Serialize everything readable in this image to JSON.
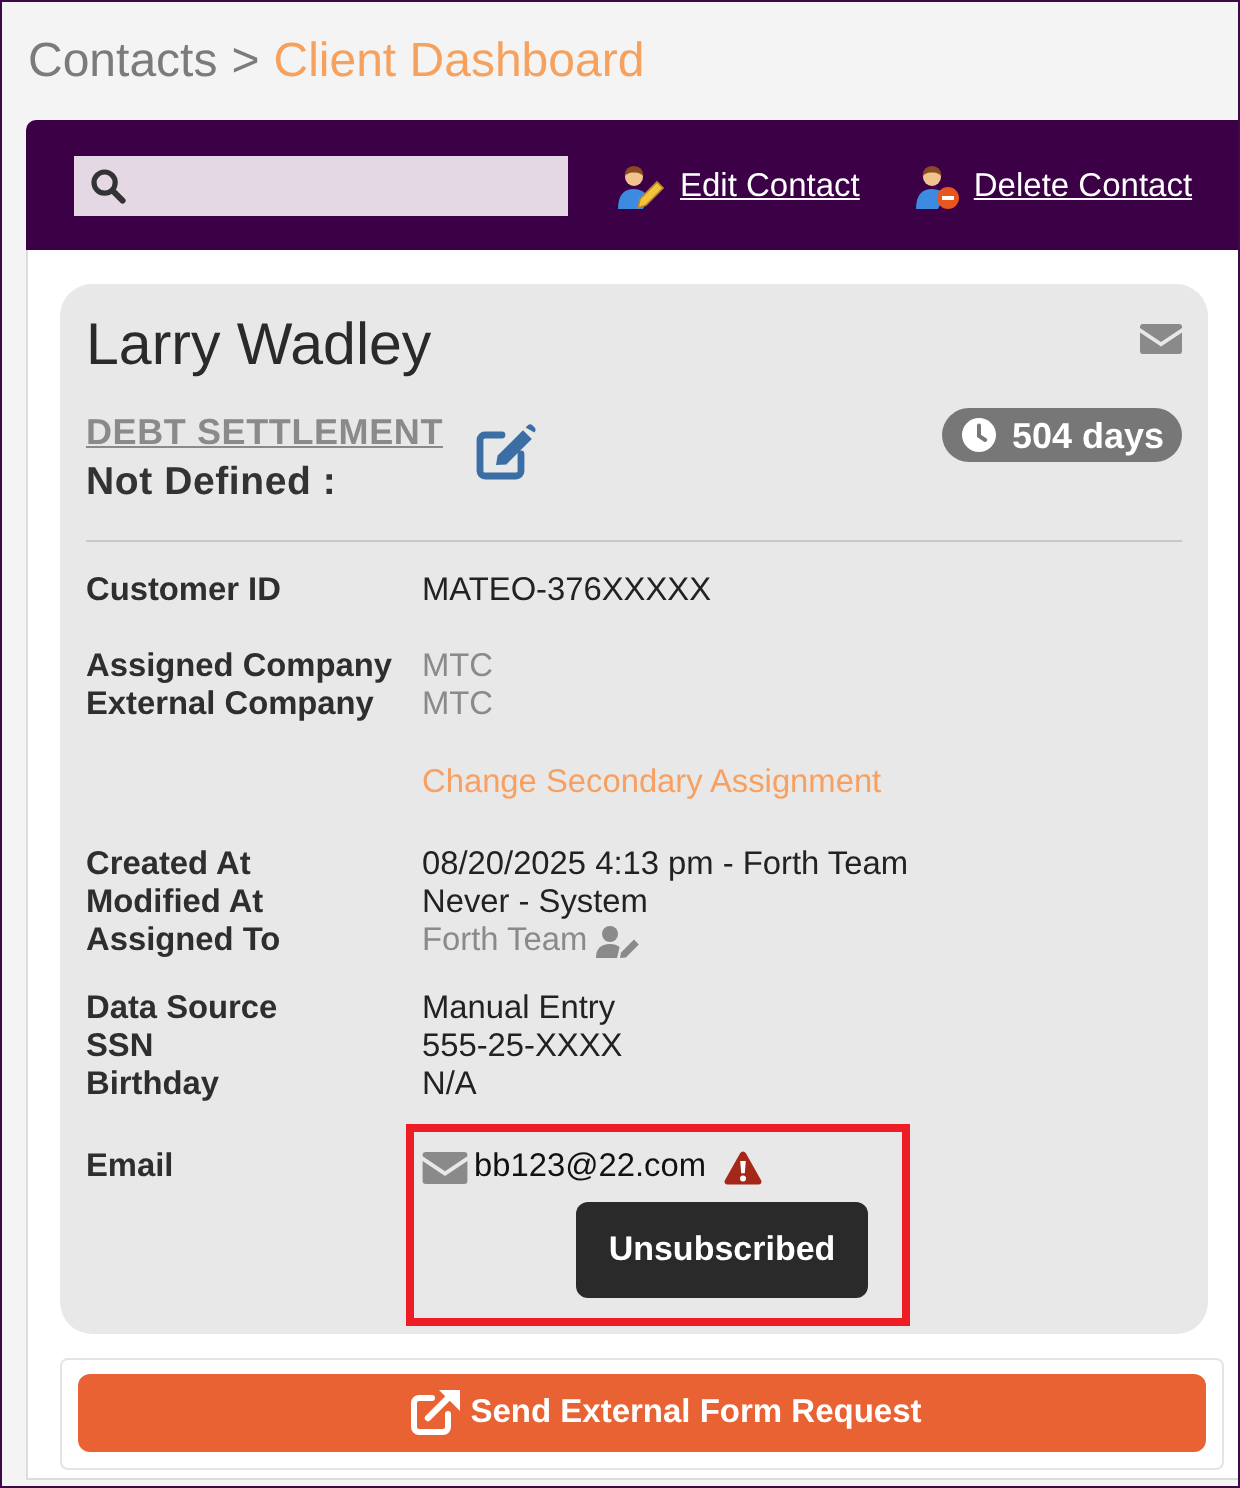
{
  "breadcrumb": {
    "parent": "Contacts",
    "separator": ">",
    "current": "Client Dashboard"
  },
  "toolbar": {
    "actions": [
      {
        "kind": "edit",
        "label": "Edit Contact"
      },
      {
        "kind": "delete",
        "label": "Delete Contact"
      }
    ]
  },
  "contact": {
    "name": "Larry Wadley",
    "category": "DEBT SETTLEMENT",
    "status": "Not Defined :",
    "age_badge": "504 days",
    "groups": [
      {
        "rows": [
          {
            "kind": "text",
            "label": "Customer ID",
            "value": "MATEO-376XXXXX",
            "muted": false
          }
        ]
      },
      {
        "rows": [
          {
            "kind": "text",
            "label": "Assigned Company",
            "value": "MTC",
            "muted": true
          },
          {
            "kind": "text",
            "label": "External Company",
            "value": "MTC",
            "muted": true
          }
        ]
      },
      {
        "rows": [
          {
            "kind": "link",
            "value": "Change Secondary Assignment",
            "muted": false
          }
        ]
      },
      {
        "rows": [
          {
            "kind": "text",
            "label": "Created At",
            "value": "08/20/2025 4:13 pm - Forth Team",
            "muted": false
          },
          {
            "kind": "text",
            "label": "Modified At",
            "value": "Never - System",
            "muted": false
          },
          {
            "kind": "assignee",
            "label": "Assigned To",
            "value": "Forth Team",
            "muted": true
          }
        ]
      },
      {
        "rows": [
          {
            "kind": "text",
            "label": "Data Source",
            "value": "Manual Entry",
            "muted": false
          },
          {
            "kind": "text",
            "label": "SSN",
            "value": "555-25-XXXX",
            "muted": false
          },
          {
            "kind": "text",
            "label": "Birthday",
            "value": "N/A",
            "muted": false
          }
        ]
      },
      {
        "rows": [
          {
            "kind": "email",
            "label": "Email",
            "value": "bb123@22.com",
            "muted": false,
            "warning": true,
            "tooltip": "Unsubscribed",
            "highlighted": true
          }
        ]
      }
    ]
  },
  "footer": {
    "button": "Send External Form Request"
  }
}
